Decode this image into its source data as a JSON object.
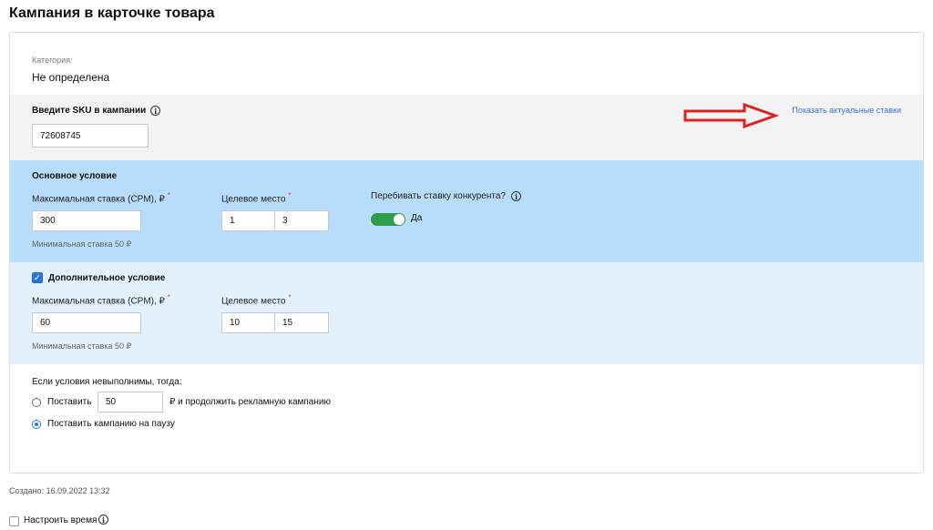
{
  "page": {
    "title": "Кампания в карточке товара"
  },
  "category": {
    "label": "Категория:",
    "value": "Не определена"
  },
  "sku": {
    "label": "Введите SKU в кампании",
    "value": "72608745",
    "show_rates_link": "Показать актуальные ставки"
  },
  "main_condition": {
    "title": "Основное условие",
    "max_bid_label": "Максимальная ставка (CPM), ₽",
    "max_bid_value": "300",
    "target_place_label": "Целевое место",
    "place_from": "1",
    "place_to": "3",
    "beat_competitor_label": "Перебивать ставку конкурента?",
    "beat_competitor_value": "Да",
    "beat_competitor_on": true,
    "min_rate": "Минимальная ставка 50 ₽"
  },
  "extra_condition": {
    "checked": true,
    "title": "Дополнительное условие",
    "max_bid_label": "Максимальная ставка (CPM), ₽",
    "max_bid_value": "60",
    "target_place_label": "Целевое место",
    "place_from": "10",
    "place_to": "15",
    "min_rate": "Минимальная ставка 50 ₽"
  },
  "fallback": {
    "title": "Если условия невыполнимы, тогда:",
    "option_set_label": "Поставить",
    "option_set_value": "50",
    "option_set_suffix": "₽ и продолжить рекламную кампанию",
    "option_pause_label": "Поставить кампанию на паузу",
    "selected": "pause"
  },
  "footer": {
    "created": "Создано: 16.09.2022 13:32",
    "set_time_label": "Настроить время"
  },
  "colors": {
    "main_bg": "#b8dcfc",
    "extra_bg": "#e3f1fd",
    "sku_bg": "#f3f3f3",
    "toggle_on": "#2e9e4a",
    "accent": "#2a73d8",
    "link": "#3a6ed6",
    "annotation_arrow": "#e02020"
  },
  "icons": [
    "info-icon",
    "checkbox-icon",
    "red-arrow-icon"
  ]
}
